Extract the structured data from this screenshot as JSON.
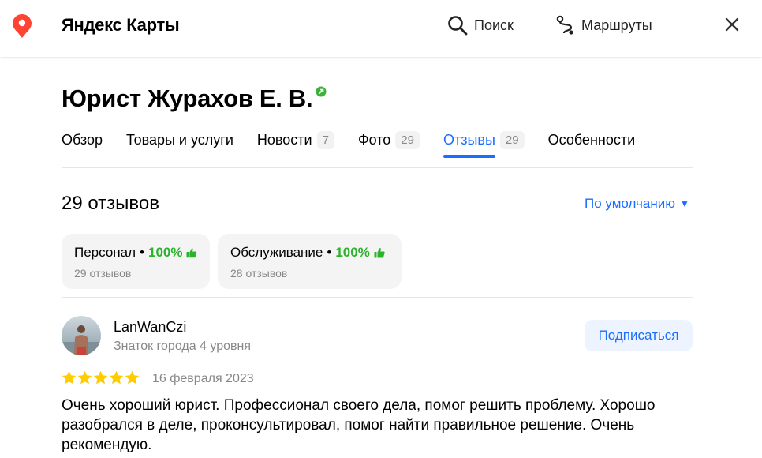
{
  "header": {
    "brand": "Яндекс Карты",
    "search_label": "Поиск",
    "routes_label": "Маршруты"
  },
  "org": {
    "title": "Юрист Журахов Е. В."
  },
  "tabs": [
    {
      "label": "Обзор",
      "count": ""
    },
    {
      "label": "Товары и услуги",
      "count": ""
    },
    {
      "label": "Новости",
      "count": "7"
    },
    {
      "label": "Фото",
      "count": "29"
    },
    {
      "label": "Отзывы",
      "count": "29"
    },
    {
      "label": "Особенности",
      "count": ""
    }
  ],
  "reviews": {
    "count_label": "29 отзывов",
    "sort_label": "По умолчанию",
    "aspects": [
      {
        "name": "Персонал",
        "percent": "100%",
        "sub": "29 отзывов"
      },
      {
        "name": "Обслуживание",
        "percent": "100%",
        "sub": "28 отзывов"
      }
    ],
    "items": [
      {
        "author": "LanWanCzi",
        "level": "Знаток города 4 уровня",
        "subscribe_label": "Подписаться",
        "rating": 5,
        "date": "16 февраля 2023",
        "text": "Очень хороший юрист. Профессионал своего дела, помог решить проблему. Хорошо разобрался в деле, проконсультировал, помог найти правильное решение. Очень рекомендую."
      }
    ]
  },
  "colors": {
    "accent": "#196dff",
    "positive": "#2bb32b",
    "star": "#fc0",
    "pin": "#f43"
  }
}
